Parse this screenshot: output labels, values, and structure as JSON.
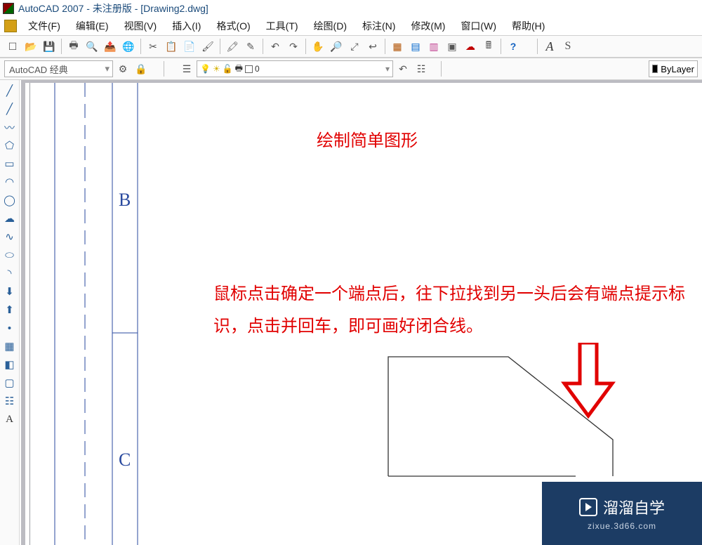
{
  "title": "AutoCAD 2007 - 未注册版 - [Drawing2.dwg]",
  "menu": {
    "file": "文件(F)",
    "edit": "编辑(E)",
    "view": "视图(V)",
    "insert": "插入(I)",
    "format": "格式(O)",
    "tools": "工具(T)",
    "draw": "绘图(D)",
    "dimension": "标注(N)",
    "modify": "修改(M)",
    "window": "窗口(W)",
    "help": "帮助(H)"
  },
  "workspace": {
    "current": "AutoCAD 经典"
  },
  "layer": {
    "current": "0"
  },
  "linetype": {
    "current": "ByLayer"
  },
  "annotations": {
    "title": "绘制简单图形",
    "body": "鼠标点击确定一个端点后，往下拉找到另一头后会有端点提示标识，点击并回车，即可画好闭合线。"
  },
  "labels_in_canvas": {
    "B": "B",
    "C": "C"
  },
  "watermark": {
    "brand": "溜溜自学",
    "url": "zixue.3d66.com"
  },
  "textstyle_letter": "A",
  "style_sample": "S"
}
